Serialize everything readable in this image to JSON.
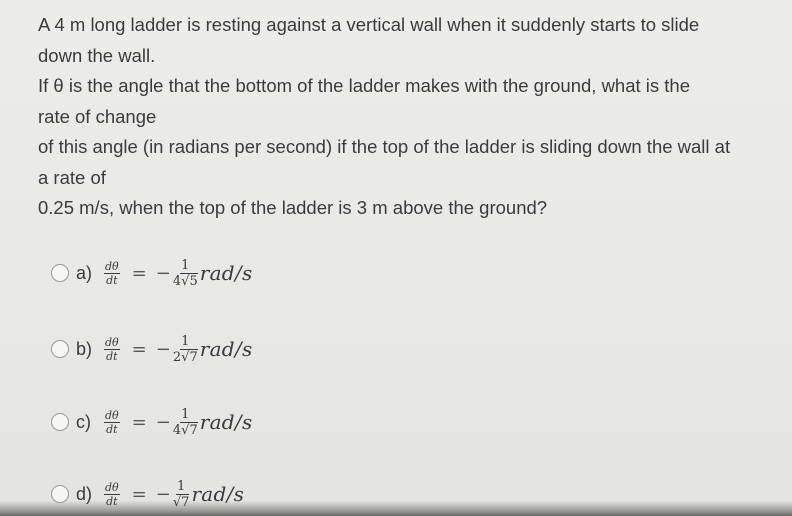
{
  "question": {
    "lines": [
      "A 4 m long ladder is resting against a vertical wall when it suddenly starts to slide",
      "down the wall.",
      "If θ is the angle that the bottom of the ladder makes with the ground, what is the",
      "rate of change",
      "of this angle (in radians per second) if the top of the ladder is sliding down the wall at",
      "a rate of",
      "0.25 m/s, when the top of the ladder is 3 m above the ground?"
    ]
  },
  "options": [
    {
      "label": "a)",
      "lhs_num": "dθ",
      "lhs_den": "dt",
      "equals": "=",
      "sign": "−",
      "rhs_num": "1",
      "rhs_coef": "4",
      "rhs_sqrt_symbol": "√",
      "rhs_radicand": "5",
      "unit": "rad/s",
      "selected": false
    },
    {
      "label": "b)",
      "lhs_num": "dθ",
      "lhs_den": "dt",
      "equals": "=",
      "sign": "−",
      "rhs_num": "1",
      "rhs_coef": "2",
      "rhs_sqrt_symbol": "√",
      "rhs_radicand": "7",
      "unit": "rad/s",
      "selected": false
    },
    {
      "label": "c)",
      "lhs_num": "dθ",
      "lhs_den": "dt",
      "equals": "=",
      "sign": "−",
      "rhs_num": "1",
      "rhs_coef": "4",
      "rhs_sqrt_symbol": "√",
      "rhs_radicand": "7",
      "unit": "rad/s",
      "selected": false
    },
    {
      "label": "d)",
      "lhs_num": "dθ",
      "lhs_den": "dt",
      "equals": "=",
      "sign": "−",
      "rhs_num": "1",
      "rhs_coef": "",
      "rhs_sqrt_symbol": "√",
      "rhs_radicand": "7",
      "unit": "rad/s",
      "selected": false
    }
  ]
}
